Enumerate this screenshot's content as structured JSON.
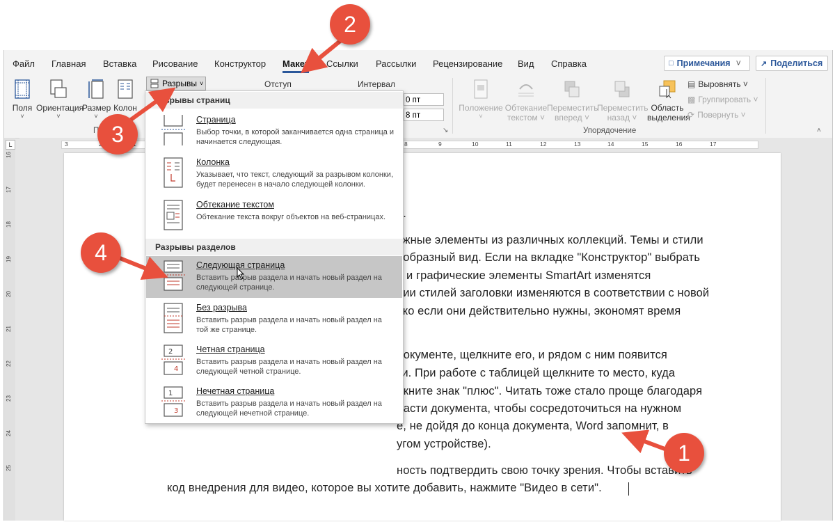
{
  "tabs": [
    "Файл",
    "Главная",
    "Вставка",
    "Рисование",
    "Конструктор",
    "Макет",
    "Ссылки",
    "Рассылки",
    "Рецензирование",
    "Вид",
    "Справка"
  ],
  "active_tab": "Макет",
  "tab_buttons": {
    "comments": "Примечания",
    "share": "Поделиться"
  },
  "ribbon": {
    "page_setup": {
      "fields": "Поля",
      "orientation": "Ориентация",
      "size": "Размер",
      "columns": "Колон",
      "breaks": "Разрывы",
      "group_label_partial": "П"
    },
    "paragraph": {
      "indent": "Отступ",
      "spacing": "Интервал",
      "val1": "0 пт",
      "val2": "8 пт"
    },
    "arrange": {
      "position_1": "Положение",
      "position_2": "",
      "wrap_1": "Обтекание",
      "wrap_2": "текстом ˅",
      "forward_1": "Переместить",
      "forward_2": "вперед ˅",
      "backward_1": "Переместить",
      "backward_2": "назад ˅",
      "pane_1": "Область",
      "pane_2": "выделения",
      "align": "Выровнять ˅",
      "group": "Группировать ˅",
      "rotate": "Повернуть ˅",
      "group_label": "Упорядочение"
    }
  },
  "ruler_numbers": [
    "3",
    "2",
    "1",
    "1",
    "2",
    "3",
    "4",
    "5",
    "6",
    "7",
    "8",
    "9",
    "10",
    "11",
    "12",
    "13",
    "14",
    "15",
    "16",
    "17"
  ],
  "vertical_ruler_numbers": [
    "16",
    "17",
    "18",
    "19",
    "20",
    "21",
    "22",
    "23",
    "24",
    "25"
  ],
  "dropdown": {
    "section1_header": "Разрывы страниц",
    "section2_header": "Разрывы разделов",
    "items": [
      {
        "title": "Страница",
        "desc": "Выбор точки, в которой заканчивается одна страница и начинается следующая."
      },
      {
        "title": "Колонка",
        "desc": "Указывает, что текст, следующий за разрывом колонки, будет перенесен в начало следующей колонки."
      },
      {
        "title": "Обтекание текстом",
        "desc": "Обтекание текста вокруг объектов на веб-страницах."
      },
      {
        "title": "Следующая страница",
        "desc": "Вставить разрыв раздела и начать новый раздел на следующей странице."
      },
      {
        "title": "Без разрыва",
        "desc": "Вставить разрыв раздела и начать новый раздел на той же странице."
      },
      {
        "title": "Четная страница",
        "desc": "Вставить разрыв раздела и начать новый раздел на следующей четной странице."
      },
      {
        "title": "Нечетная страница",
        "desc": "Вставить разрыв раздела и начать новый раздел на следующей нечетной странице."
      }
    ],
    "highlighted_index": 3
  },
  "document_lines": [
    "е.",
    "ужные элементы из различных коллекций. Темы и стили",
    "ообразный вид. Если на вкладке \"Конструктор\" выбрать",
    "и графические элементы SmartArt изменятся",
    "нии стилей заголовки изменяются в соответствии с новой",
    "ько если они действительно нужны, экономят время",
    "документе, щелкните его, и рядом с ним появится",
    "ки. При работе с таблицей щелкните то место, куда",
    "лкните знак \"плюс\". Читать тоже стало проще благодаря",
    "ласти документа, чтобы сосредоточиться на нужном",
    "е, не дойдя до конца документа, Word запомнит, в",
    "угом устройстве).",
    "ность подтвердить свою точку зрения. Чтобы вставить",
    "код внедрения для видео, которое вы хотите добавить, нажмите \"Видео в сети\"."
  ],
  "callouts": [
    "1",
    "2",
    "3",
    "4"
  ],
  "colors": {
    "accent": "#2b579a",
    "callout": "#e8503d",
    "highlight": "#c6c6c6",
    "breaks_red": "#c0392b"
  }
}
